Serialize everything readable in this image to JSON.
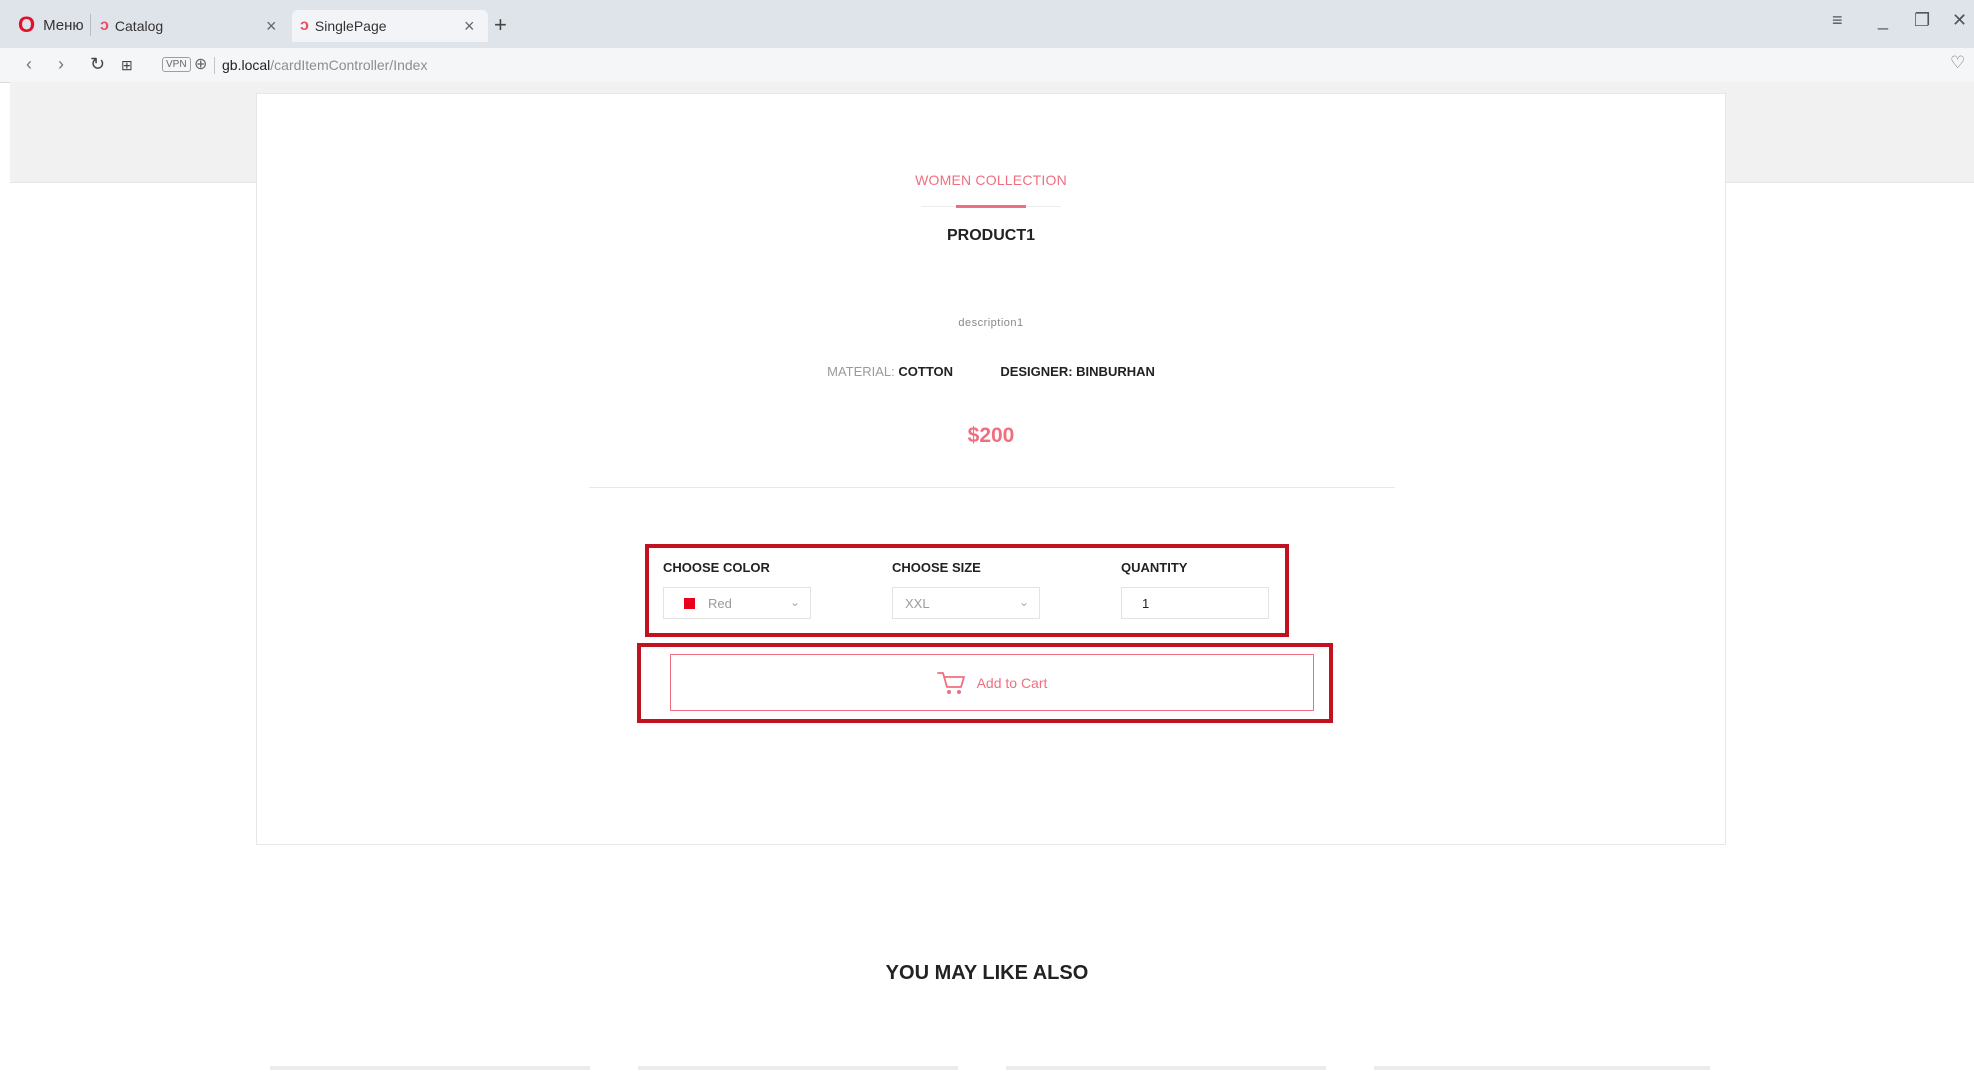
{
  "browser": {
    "menu_label": "Меню",
    "tabs": [
      {
        "title": "Catalog",
        "active": false
      },
      {
        "title": "SinglePage",
        "active": true
      }
    ],
    "new_tab": "+",
    "address": {
      "vpn_badge": "VPN",
      "host": "gb.local",
      "path": "/cardItemController/Index"
    }
  },
  "product": {
    "collection": "WOMEN COLLECTION",
    "name": "PRODUCT1",
    "description": "description1",
    "material_label": "MATERIAL:",
    "material_value": "COTTON",
    "designer_label": "DESIGNER:",
    "designer_value": "BINBURHAN",
    "price": "$200"
  },
  "options": {
    "color_label": "CHOOSE COLOR",
    "color_value": "Red",
    "color_swatch": "#e8001c",
    "size_label": "CHOOSE SIZE",
    "size_value": "XXL",
    "quantity_label": "QUANTITY",
    "quantity_value": "1"
  },
  "cart": {
    "button_label": "Add to Cart",
    "icon": "cart-icon"
  },
  "related": {
    "title": "YOU MAY LIKE ALSO"
  },
  "colors": {
    "accent": "#f16e80",
    "highlight_box": "#c3121f"
  }
}
